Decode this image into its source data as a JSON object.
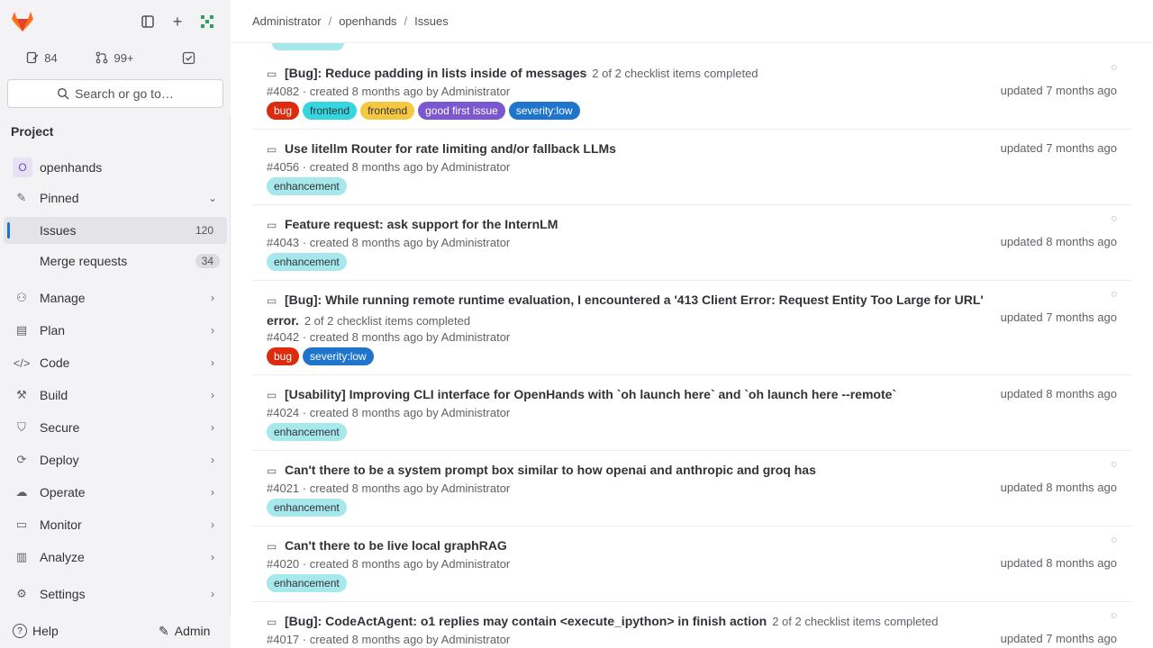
{
  "sidebar": {
    "counters": {
      "issues": "84",
      "merge_requests": "99+"
    },
    "search_label": "Search or go to…",
    "section_title": "Project",
    "project_initial": "O",
    "project_name": "openhands",
    "nav": {
      "pinned": "Pinned",
      "issues": "Issues",
      "issues_count": "120",
      "merge_requests": "Merge requests",
      "merge_requests_count": "34",
      "manage": "Manage",
      "plan": "Plan",
      "code": "Code",
      "build": "Build",
      "secure": "Secure",
      "deploy": "Deploy",
      "operate": "Operate",
      "monitor": "Monitor",
      "analyze": "Analyze",
      "settings": "Settings"
    },
    "help": "Help",
    "admin": "Admin"
  },
  "breadcrumb": [
    "Administrator",
    "openhands",
    "Issues"
  ],
  "issues": [
    {
      "title": "[Bug]: Reduce padding in lists inside of messages",
      "checklist": "2 of 2 checklist items completed",
      "meta": "#4082 · created 8 months ago by Administrator",
      "labels": [
        {
          "text": "bug",
          "bg": "#dd2b0e",
          "fg": "#ffffff"
        },
        {
          "text": "frontend",
          "bg": "#36d6e0",
          "fg": "#333238"
        },
        {
          "text": "frontend",
          "bg": "#f5c842",
          "fg": "#333238"
        },
        {
          "text": "good first issue",
          "bg": "#7b58cf",
          "fg": "#ffffff"
        },
        {
          "text": "severity:low",
          "bg": "#1f75cb",
          "fg": "#ffffff"
        }
      ],
      "updated": "updated 7 months ago"
    },
    {
      "title": "Use litellm Router for rate limiting and/or fallback LLMs",
      "meta": "#4056 · created 8 months ago by Administrator",
      "labels": [
        {
          "text": "enhancement",
          "bg": "#a6e8ec",
          "fg": "#333238"
        }
      ],
      "updated": "updated 7 months ago"
    },
    {
      "title": "Feature request: ask support for the InternLM",
      "meta": "#4043 · created 8 months ago by Administrator",
      "labels": [
        {
          "text": "enhancement",
          "bg": "#a6e8ec",
          "fg": "#333238"
        }
      ],
      "updated": "updated 8 months ago"
    },
    {
      "title": "[Bug]: While running remote runtime evaluation, I encountered a '413 Client Error: Request Entity Too Large for URL' error.",
      "checklist": "2 of 2 checklist items completed",
      "meta": "#4042 · created 8 months ago by Administrator",
      "labels": [
        {
          "text": "bug",
          "bg": "#dd2b0e",
          "fg": "#ffffff"
        },
        {
          "text": "severity:low",
          "bg": "#1f75cb",
          "fg": "#ffffff"
        }
      ],
      "updated": "updated 7 months ago"
    },
    {
      "title": "[Usability] Improving CLI interface for OpenHands with `oh launch here` and `oh launch here --remote`",
      "meta": "#4024 · created 8 months ago by Administrator",
      "labels": [
        {
          "text": "enhancement",
          "bg": "#a6e8ec",
          "fg": "#333238"
        }
      ],
      "updated": "updated 8 months ago"
    },
    {
      "title": "Can't there to be a system prompt box similar to how openai and anthropic and groq has",
      "meta": "#4021 · created 8 months ago by Administrator",
      "labels": [
        {
          "text": "enhancement",
          "bg": "#a6e8ec",
          "fg": "#333238"
        }
      ],
      "updated": "updated 8 months ago"
    },
    {
      "title": "Can't there to be live local graphRAG",
      "meta": "#4020 · created 8 months ago by Administrator",
      "labels": [
        {
          "text": "enhancement",
          "bg": "#a6e8ec",
          "fg": "#333238"
        }
      ],
      "updated": "updated 8 months ago"
    },
    {
      "title": "[Bug]: CodeActAgent: o1 replies may contain <execute_ipython> in finish action",
      "checklist": "2 of 2 checklist items completed",
      "meta": "#4017 · created 8 months ago by Administrator",
      "labels": [],
      "updated": "updated 7 months ago"
    }
  ]
}
